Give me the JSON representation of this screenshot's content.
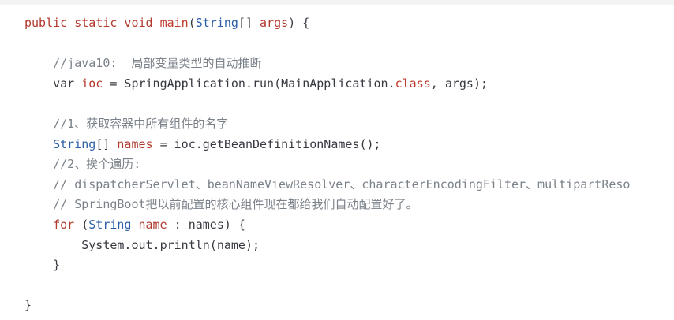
{
  "code": {
    "lines": [
      {
        "segments": [
          {
            "t": "public static void ",
            "c": "kw2"
          },
          {
            "t": "main",
            "c": "fn"
          },
          {
            "t": "(",
            "c": "plain"
          },
          {
            "t": "String",
            "c": "type"
          },
          {
            "t": "[] ",
            "c": "plain"
          },
          {
            "t": "args",
            "c": "var"
          },
          {
            "t": ") {",
            "c": "plain"
          }
        ]
      },
      {
        "segments": []
      },
      {
        "segments": [
          {
            "t": "    //java10:  局部变量类型的自动推断",
            "c": "cmt"
          }
        ]
      },
      {
        "segments": [
          {
            "t": "    var ",
            "c": "plain"
          },
          {
            "t": "ioc",
            "c": "var"
          },
          {
            "t": " = SpringApplication.run(MainApplication.",
            "c": "plain"
          },
          {
            "t": "class",
            "c": "class"
          },
          {
            "t": ", args);",
            "c": "plain"
          }
        ]
      },
      {
        "segments": []
      },
      {
        "segments": [
          {
            "t": "    //1、获取容器中所有组件的名字",
            "c": "cmt"
          }
        ]
      },
      {
        "segments": [
          {
            "t": "    ",
            "c": "plain"
          },
          {
            "t": "String",
            "c": "type"
          },
          {
            "t": "[] ",
            "c": "plain"
          },
          {
            "t": "names",
            "c": "var"
          },
          {
            "t": " = ioc.getBeanDefinitionNames();",
            "c": "plain"
          }
        ]
      },
      {
        "segments": [
          {
            "t": "    //2、挨个遍历:",
            "c": "cmt"
          }
        ]
      },
      {
        "segments": [
          {
            "t": "    // dispatcherServlet、beanNameViewResolver、characterEncodingFilter、multipartReso",
            "c": "cmt"
          }
        ]
      },
      {
        "segments": [
          {
            "t": "    // SpringBoot把以前配置的核心组件现在都给我们自动配置好了。",
            "c": "cmt"
          }
        ]
      },
      {
        "segments": [
          {
            "t": "    ",
            "c": "plain"
          },
          {
            "t": "for",
            "c": "kw2"
          },
          {
            "t": " (",
            "c": "plain"
          },
          {
            "t": "String",
            "c": "type"
          },
          {
            "t": " ",
            "c": "plain"
          },
          {
            "t": "name",
            "c": "var"
          },
          {
            "t": " : names) {",
            "c": "plain"
          }
        ]
      },
      {
        "segments": [
          {
            "t": "        System.out.println(name);",
            "c": "plain"
          }
        ]
      },
      {
        "segments": [
          {
            "t": "    }",
            "c": "plain"
          }
        ]
      },
      {
        "segments": []
      },
      {
        "segments": [
          {
            "t": "}",
            "c": "plain"
          }
        ]
      }
    ]
  }
}
